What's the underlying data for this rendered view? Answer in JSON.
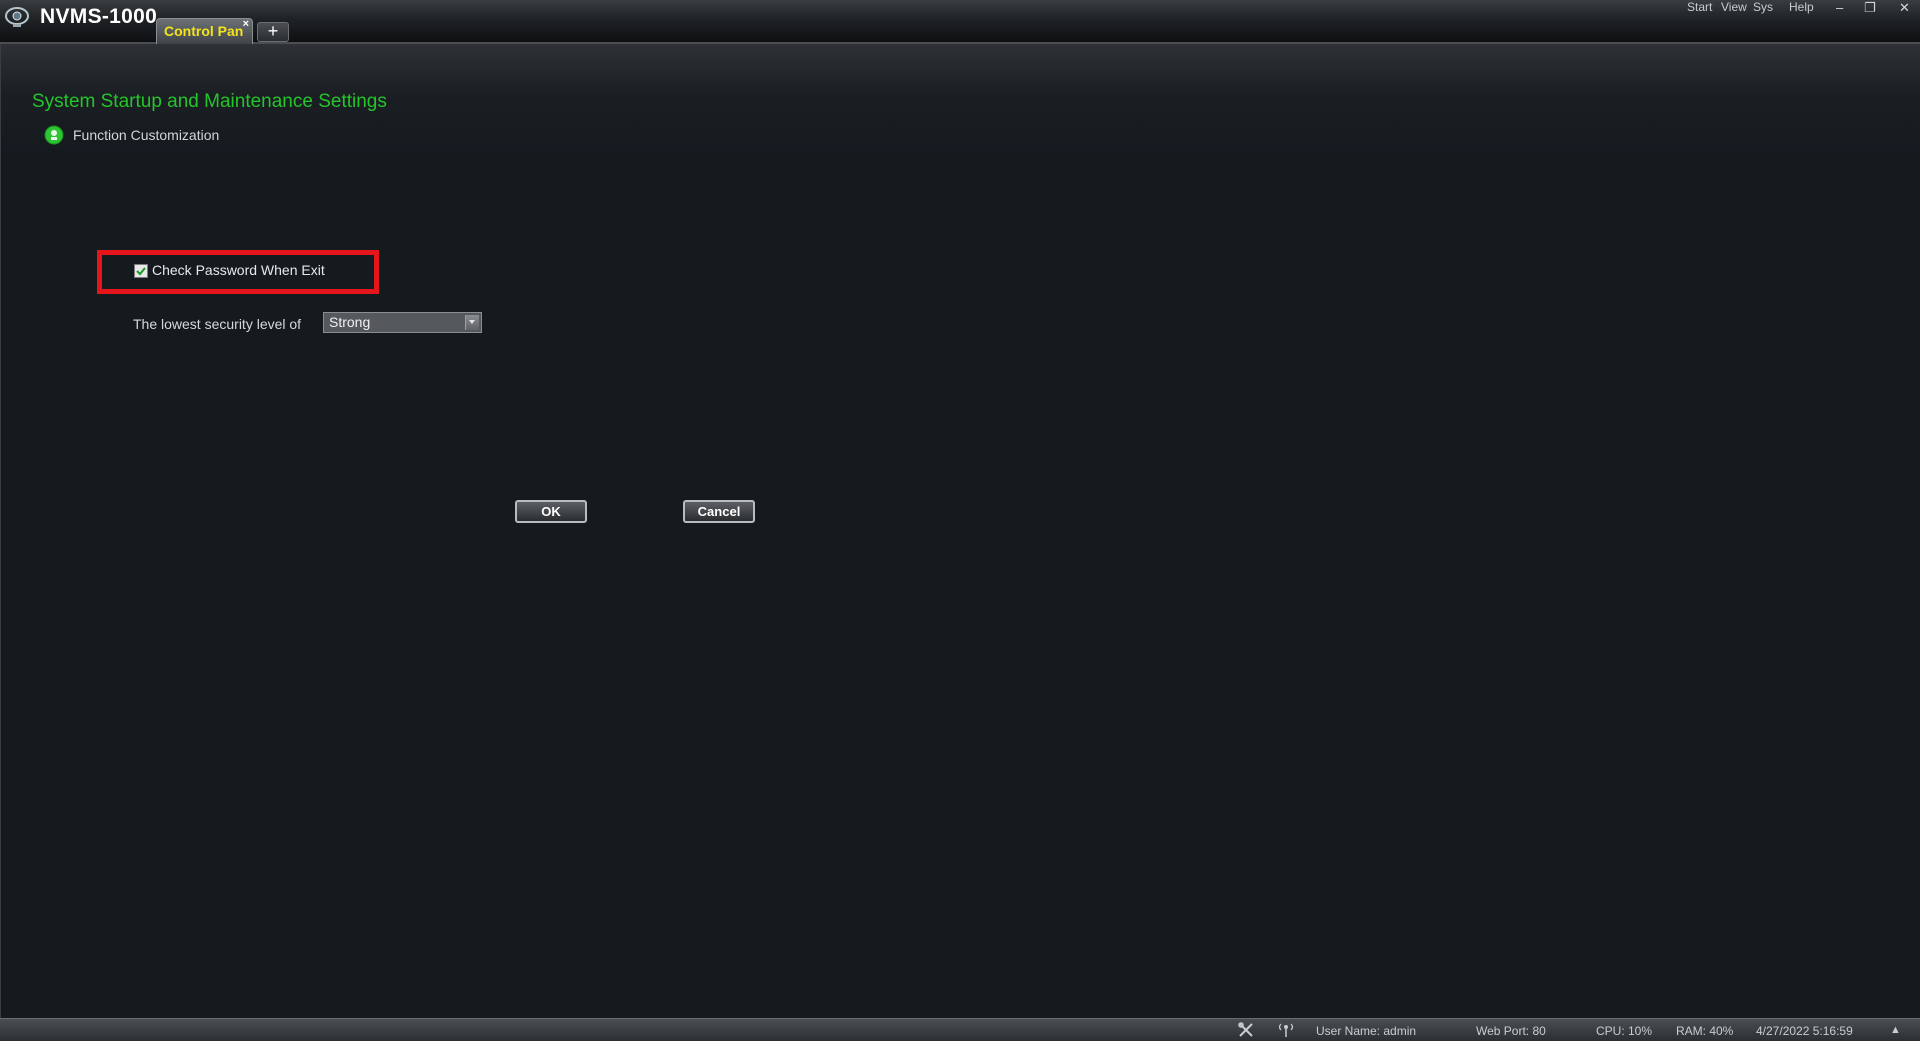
{
  "app": {
    "title": "NVMS-1000",
    "logo_icon": "camera-globe-icon"
  },
  "tabs": [
    {
      "label": "Control Pan",
      "close": "×",
      "active": true
    }
  ],
  "tab_add_label": "+",
  "menu": {
    "start": "Start",
    "view": "View",
    "sys": "Sys",
    "help": "Help"
  },
  "window_controls": {
    "minimize": "‒",
    "restore": "❐",
    "close": "✕"
  },
  "page": {
    "title": "System Startup and Maintenance Settings",
    "section_label": "Function Customization",
    "section_icon": "green-gear-icon"
  },
  "form": {
    "check_password_label": "Check Password When Exit",
    "check_password_checked": true,
    "security_label": "The lowest security level of",
    "security_value": "Strong"
  },
  "buttons": {
    "ok": "OK",
    "cancel": "Cancel"
  },
  "status": {
    "user_name": "User Name: admin",
    "web_port": "Web Port: 80",
    "cpu": "CPU: 10%",
    "ram": "RAM: 40%",
    "datetime": "4/27/2022 5:16:59",
    "expand": "▲"
  },
  "colors": {
    "accent_green": "#25c42a",
    "tab_text_yellow": "#f4e21a",
    "highlight_red": "#e4161b",
    "background": "#151a1f"
  }
}
